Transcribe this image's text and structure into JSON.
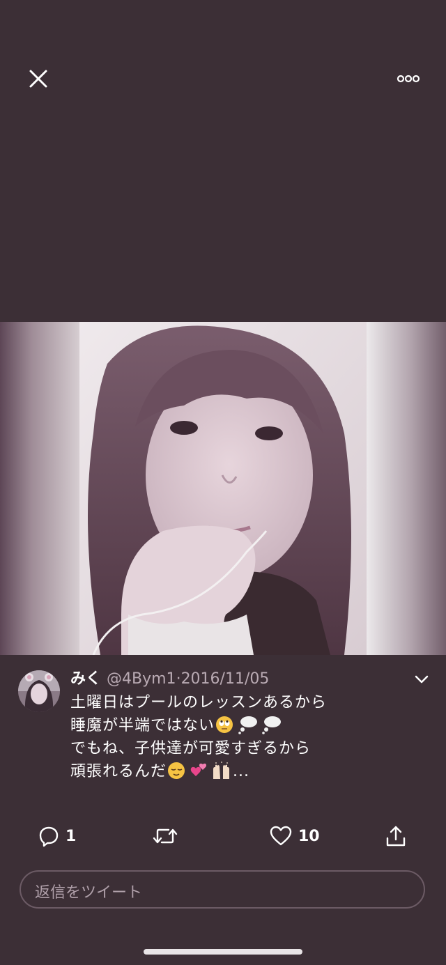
{
  "toolbar": {
    "close_icon": "close-icon",
    "more_icon": "more-dots-icon"
  },
  "tweet": {
    "display_name": "みく",
    "handle": "@4Bym1",
    "separator": "·",
    "date": "2016/11/05",
    "lines": [
      "土曜日はプールのレッスンあるから",
      "睡魔が半端ではない",
      "でもね、子供達が可愛すぎるから",
      "頑張れるんだ"
    ],
    "line2_emoji": [
      "rolling-eyes-emoji",
      "thought-bubble-emoji",
      "thought-bubble-emoji"
    ],
    "line4_emoji": [
      "relieved-face-emoji",
      "two-hearts-emoji",
      "raising-hands-emoji"
    ],
    "ellipsis": "..."
  },
  "actions": {
    "reply_count": "1",
    "retweet_count": "",
    "like_count": "10"
  },
  "reply_placeholder": "返信をツイート",
  "colors": {
    "background": "#3c2f36",
    "secondary_text": "#b9aab3",
    "heart_pink": "#e8458b"
  }
}
